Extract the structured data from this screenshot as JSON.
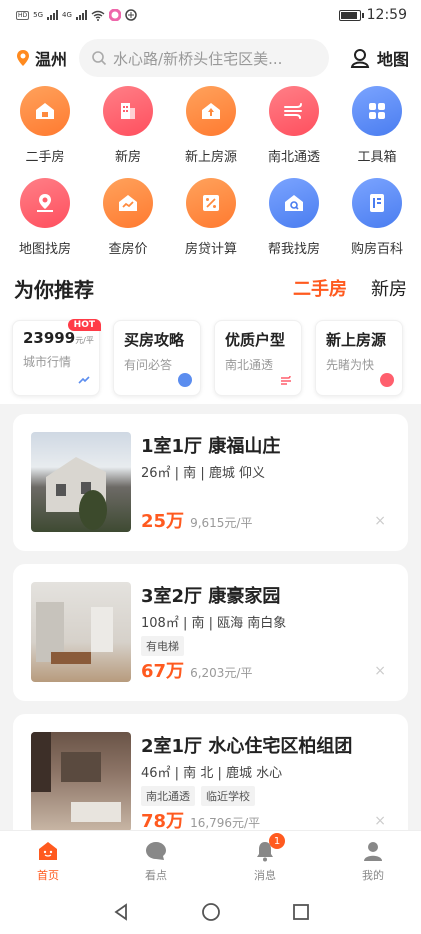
{
  "status": {
    "time": "12:59",
    "net1": "5G",
    "net2": "4G"
  },
  "header": {
    "city": "温州",
    "search_placeholder": "水心路/新桥头住宅区美...",
    "map_label": "地图"
  },
  "grid": [
    {
      "label": "二手房",
      "icon": "house-icon",
      "color": "#ff8a3d"
    },
    {
      "label": "新房",
      "icon": "building-icon",
      "color": "#ff5f6d"
    },
    {
      "label": "新上房源",
      "icon": "new-listing-icon",
      "color": "#ff8a3d"
    },
    {
      "label": "南北通透",
      "icon": "wind-icon",
      "color": "#ff5f6d"
    },
    {
      "label": "工具箱",
      "icon": "toolbox-icon",
      "color": "#5b8def"
    },
    {
      "label": "地图找房",
      "icon": "map-pin-icon",
      "color": "#ff5f6d"
    },
    {
      "label": "查房价",
      "icon": "trend-icon",
      "color": "#ff8a3d"
    },
    {
      "label": "房贷计算",
      "icon": "calculator-icon",
      "color": "#ff8a3d"
    },
    {
      "label": "帮我找房",
      "icon": "search-house-icon",
      "color": "#5b8def"
    },
    {
      "label": "购房百科",
      "icon": "book-icon",
      "color": "#5b8def"
    }
  ],
  "recommend": {
    "title": "为你推荐",
    "tab_active": "二手房",
    "tab_other": "新房"
  },
  "mini_cards": [
    {
      "title": "23999",
      "unit": "元/平",
      "sub": "城市行情",
      "badge": "HOT",
      "icon_color": "#5b8def"
    },
    {
      "title": "买房攻略",
      "sub": "有问必答",
      "icon_color": "#5b8def"
    },
    {
      "title": "优质户型",
      "sub": "南北通透",
      "icon_color": "#ff5f6d"
    },
    {
      "title": "新上房源",
      "sub": "先睹为快",
      "icon_color": "#ff5f6d"
    }
  ],
  "listings": [
    {
      "title": "1室1厅 康福山庄",
      "info": "26㎡ | 南 | 鹿城 仰义",
      "tags": [],
      "price": "25万",
      "unit_price": "9,615元/平"
    },
    {
      "title": "3室2厅 康豪家园",
      "info": "108㎡ | 南 | 瓯海 南白象",
      "tags": [
        "有电梯"
      ],
      "price": "67万",
      "unit_price": "6,203元/平"
    },
    {
      "title": "2室1厅 水心住宅区柏组团",
      "info": "46㎡ | 南 北 | 鹿城 水心",
      "tags": [
        "南北通透",
        "临近学校"
      ],
      "price": "78万",
      "unit_price": "16,796元/平"
    }
  ],
  "close_symbol": "×",
  "bottom_nav": [
    {
      "label": "首页",
      "active": true
    },
    {
      "label": "看点"
    },
    {
      "label": "消息",
      "badge": "1"
    },
    {
      "label": "我的"
    }
  ],
  "accent": "#ff5a1f"
}
